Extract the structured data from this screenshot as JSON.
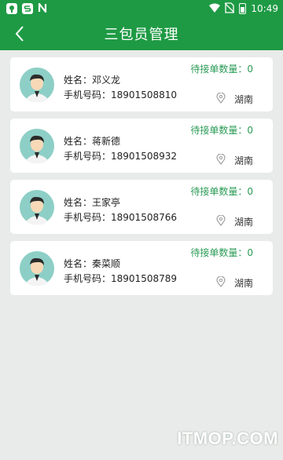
{
  "status_bar": {
    "time": "10:49",
    "left_icons": [
      "map-app-icon",
      "s-app-icon",
      "n-app-icon"
    ],
    "right_icons": [
      "wifi-icon",
      "no-sim-icon",
      "battery-icon"
    ]
  },
  "header": {
    "title": "三包员管理",
    "back_icon": "chevron-left-icon",
    "color": "#1e9a44"
  },
  "staff": [
    {
      "name_label": "姓名：",
      "name": "邓义龙",
      "phone_label": "手机号码：",
      "phone": "18901508810",
      "orders_label": "待接单数量：",
      "orders": "0",
      "region": "湖南"
    },
    {
      "name_label": "姓名：",
      "name": "蒋新德",
      "phone_label": "手机号码：",
      "phone": "18901508932",
      "orders_label": "待接单数量：",
      "orders": "0",
      "region": "湖南"
    },
    {
      "name_label": "姓名：",
      "name": "王家亭",
      "phone_label": "手机号码：",
      "phone": "18901508766",
      "orders_label": "待接单数量：",
      "orders": "0",
      "region": "湖南"
    },
    {
      "name_label": "姓名：",
      "name": "秦菜顺",
      "phone_label": "手机号码：",
      "phone": "18901508789",
      "orders_label": "待接单数量：",
      "orders": "0",
      "region": "湖南"
    }
  ],
  "watermark": "ITMOP.COM",
  "accent_green": "#2a9b55"
}
